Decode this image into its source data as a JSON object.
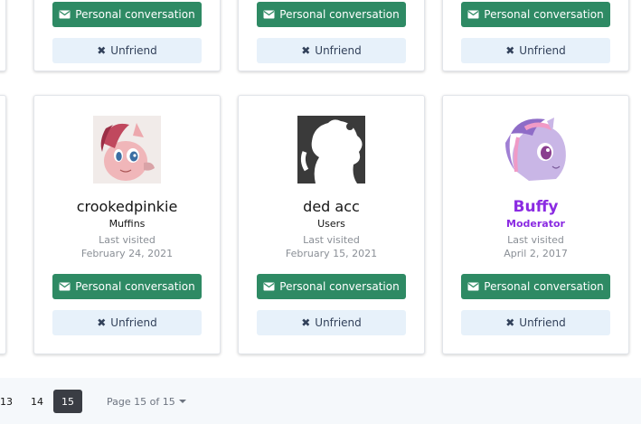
{
  "labels": {
    "personal_conversation": "Personal conversation",
    "unfriend": "Unfriend",
    "last_visited": "Last visited"
  },
  "members": [
    {
      "name": "crookedpinkie",
      "title": "Muffins",
      "last_visited": "February 24, 2021",
      "avatar": "pony-pink-avatar"
    },
    {
      "name": "ded acc",
      "title": "Users",
      "last_visited": "February 15, 2021",
      "avatar": "silhouette-avatar"
    },
    {
      "name": "Buffy",
      "title": "Moderator",
      "last_visited": "April 2, 2017",
      "avatar": "pony-lilac-avatar",
      "staff_color": "#8b2be2"
    }
  ],
  "pagination": {
    "pages": [
      "13",
      "14"
    ],
    "current": "15",
    "jump_label": "Page 15 of 15"
  },
  "colors": {
    "primary_button": "#2e8a64",
    "secondary_button": "#e7f1fa",
    "moderator": "#8b2be2",
    "current_page": "#3a3d44"
  }
}
